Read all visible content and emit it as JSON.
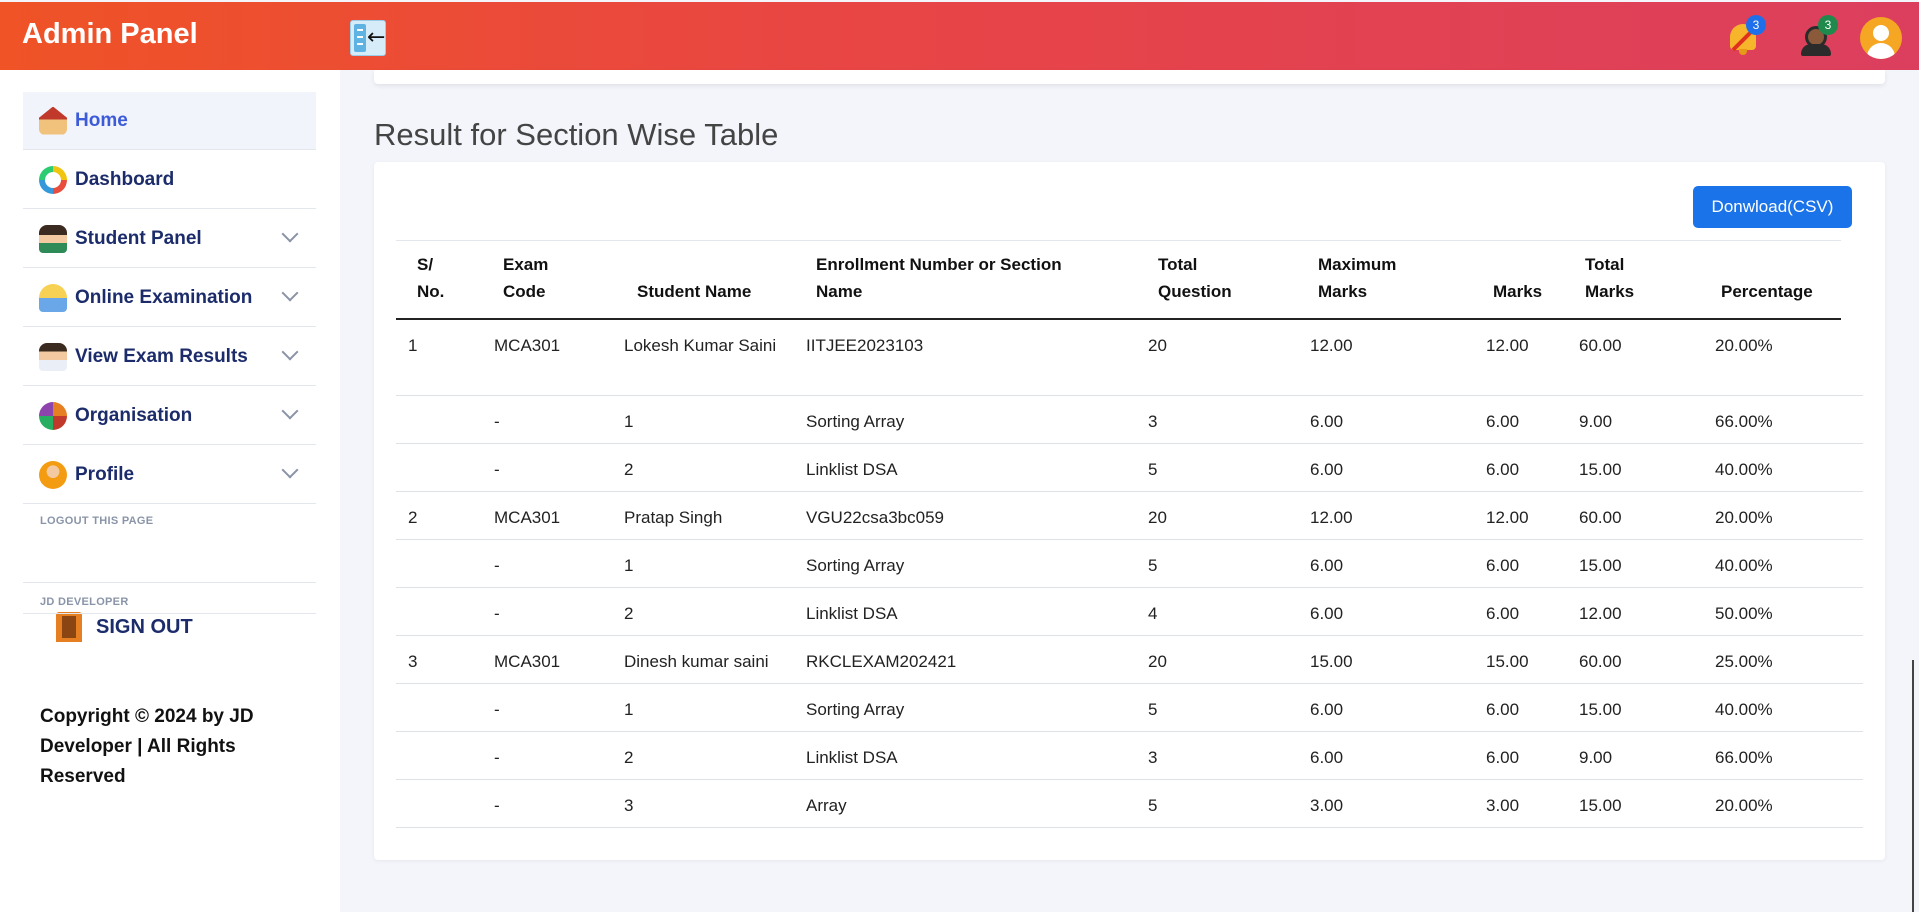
{
  "header": {
    "brand": "Admin Panel",
    "notifications_count": "3",
    "agent_count": "3",
    "gradient": [
      "#ef5326",
      "#dc3f5e"
    ]
  },
  "sidebar": {
    "items": [
      {
        "label": "Home",
        "icon": "home-icon",
        "active": true
      },
      {
        "label": "Dashboard",
        "icon": "dashboard-icon"
      },
      {
        "label": "Student Panel",
        "icon": "student-icon",
        "expandable": true
      },
      {
        "label": "Online Examination",
        "icon": "exam-icon",
        "expandable": true
      },
      {
        "label": "View Exam Results",
        "icon": "results-icon",
        "expandable": true
      },
      {
        "label": "Organisation",
        "icon": "organisation-icon",
        "expandable": true
      },
      {
        "label": "Profile",
        "icon": "profile-icon",
        "expandable": true
      }
    ],
    "logout_caption": "LOGOUT THIS PAGE",
    "signout_label": "SIGN OUT",
    "developer_caption": "JD DEVELOPER",
    "copyright": "Copyright © 2024 by JD Developer | All Rights Reserved"
  },
  "main": {
    "title": "Result for Section Wise Table",
    "download_label": "Donwload(CSV)",
    "columns": [
      {
        "l1": "S/",
        "l2": "No."
      },
      {
        "l1": "Exam",
        "l2": "Code"
      },
      {
        "l1": "",
        "l2": "Student Name"
      },
      {
        "l1": "Enrollment Number or Section",
        "l2": "Name"
      },
      {
        "l1": "Total",
        "l2": "Question"
      },
      {
        "l1": "Maximum",
        "l2": "Marks"
      },
      {
        "l1": "",
        "l2": "Marks"
      },
      {
        "l1": "Total",
        "l2": "Marks"
      },
      {
        "l1": "",
        "l2": "Percentage"
      }
    ],
    "rows": [
      [
        "1",
        "MCA301",
        "Lokesh Kumar Saini",
        "IITJEE2023103",
        "20",
        "12.00",
        "12.00",
        "60.00",
        "20.00%"
      ],
      [
        "",
        "-",
        "1",
        "Sorting Array",
        "3",
        "6.00",
        "6.00",
        "9.00",
        "66.00%"
      ],
      [
        "",
        "-",
        "2",
        "Linklist DSA",
        "5",
        "6.00",
        "6.00",
        "15.00",
        "40.00%"
      ],
      [
        "2",
        "MCA301",
        "Pratap Singh",
        "VGU22csa3bc059",
        "20",
        "12.00",
        "12.00",
        "60.00",
        "20.00%"
      ],
      [
        "",
        "-",
        "1",
        "Sorting Array",
        "5",
        "6.00",
        "6.00",
        "15.00",
        "40.00%"
      ],
      [
        "",
        "-",
        "2",
        "Linklist DSA",
        "4",
        "6.00",
        "6.00",
        "12.00",
        "50.00%"
      ],
      [
        "3",
        "MCA301",
        "Dinesh kumar saini",
        "RKCLEXAM202421",
        "20",
        "15.00",
        "15.00",
        "60.00",
        "25.00%"
      ],
      [
        "",
        "-",
        "1",
        "Sorting Array",
        "5",
        "6.00",
        "6.00",
        "15.00",
        "40.00%"
      ],
      [
        "",
        "-",
        "2",
        "Linklist DSA",
        "3",
        "6.00",
        "6.00",
        "9.00",
        "66.00%"
      ],
      [
        "",
        "-",
        "3",
        "Array",
        "5",
        "3.00",
        "3.00",
        "15.00",
        "20.00%"
      ]
    ]
  }
}
